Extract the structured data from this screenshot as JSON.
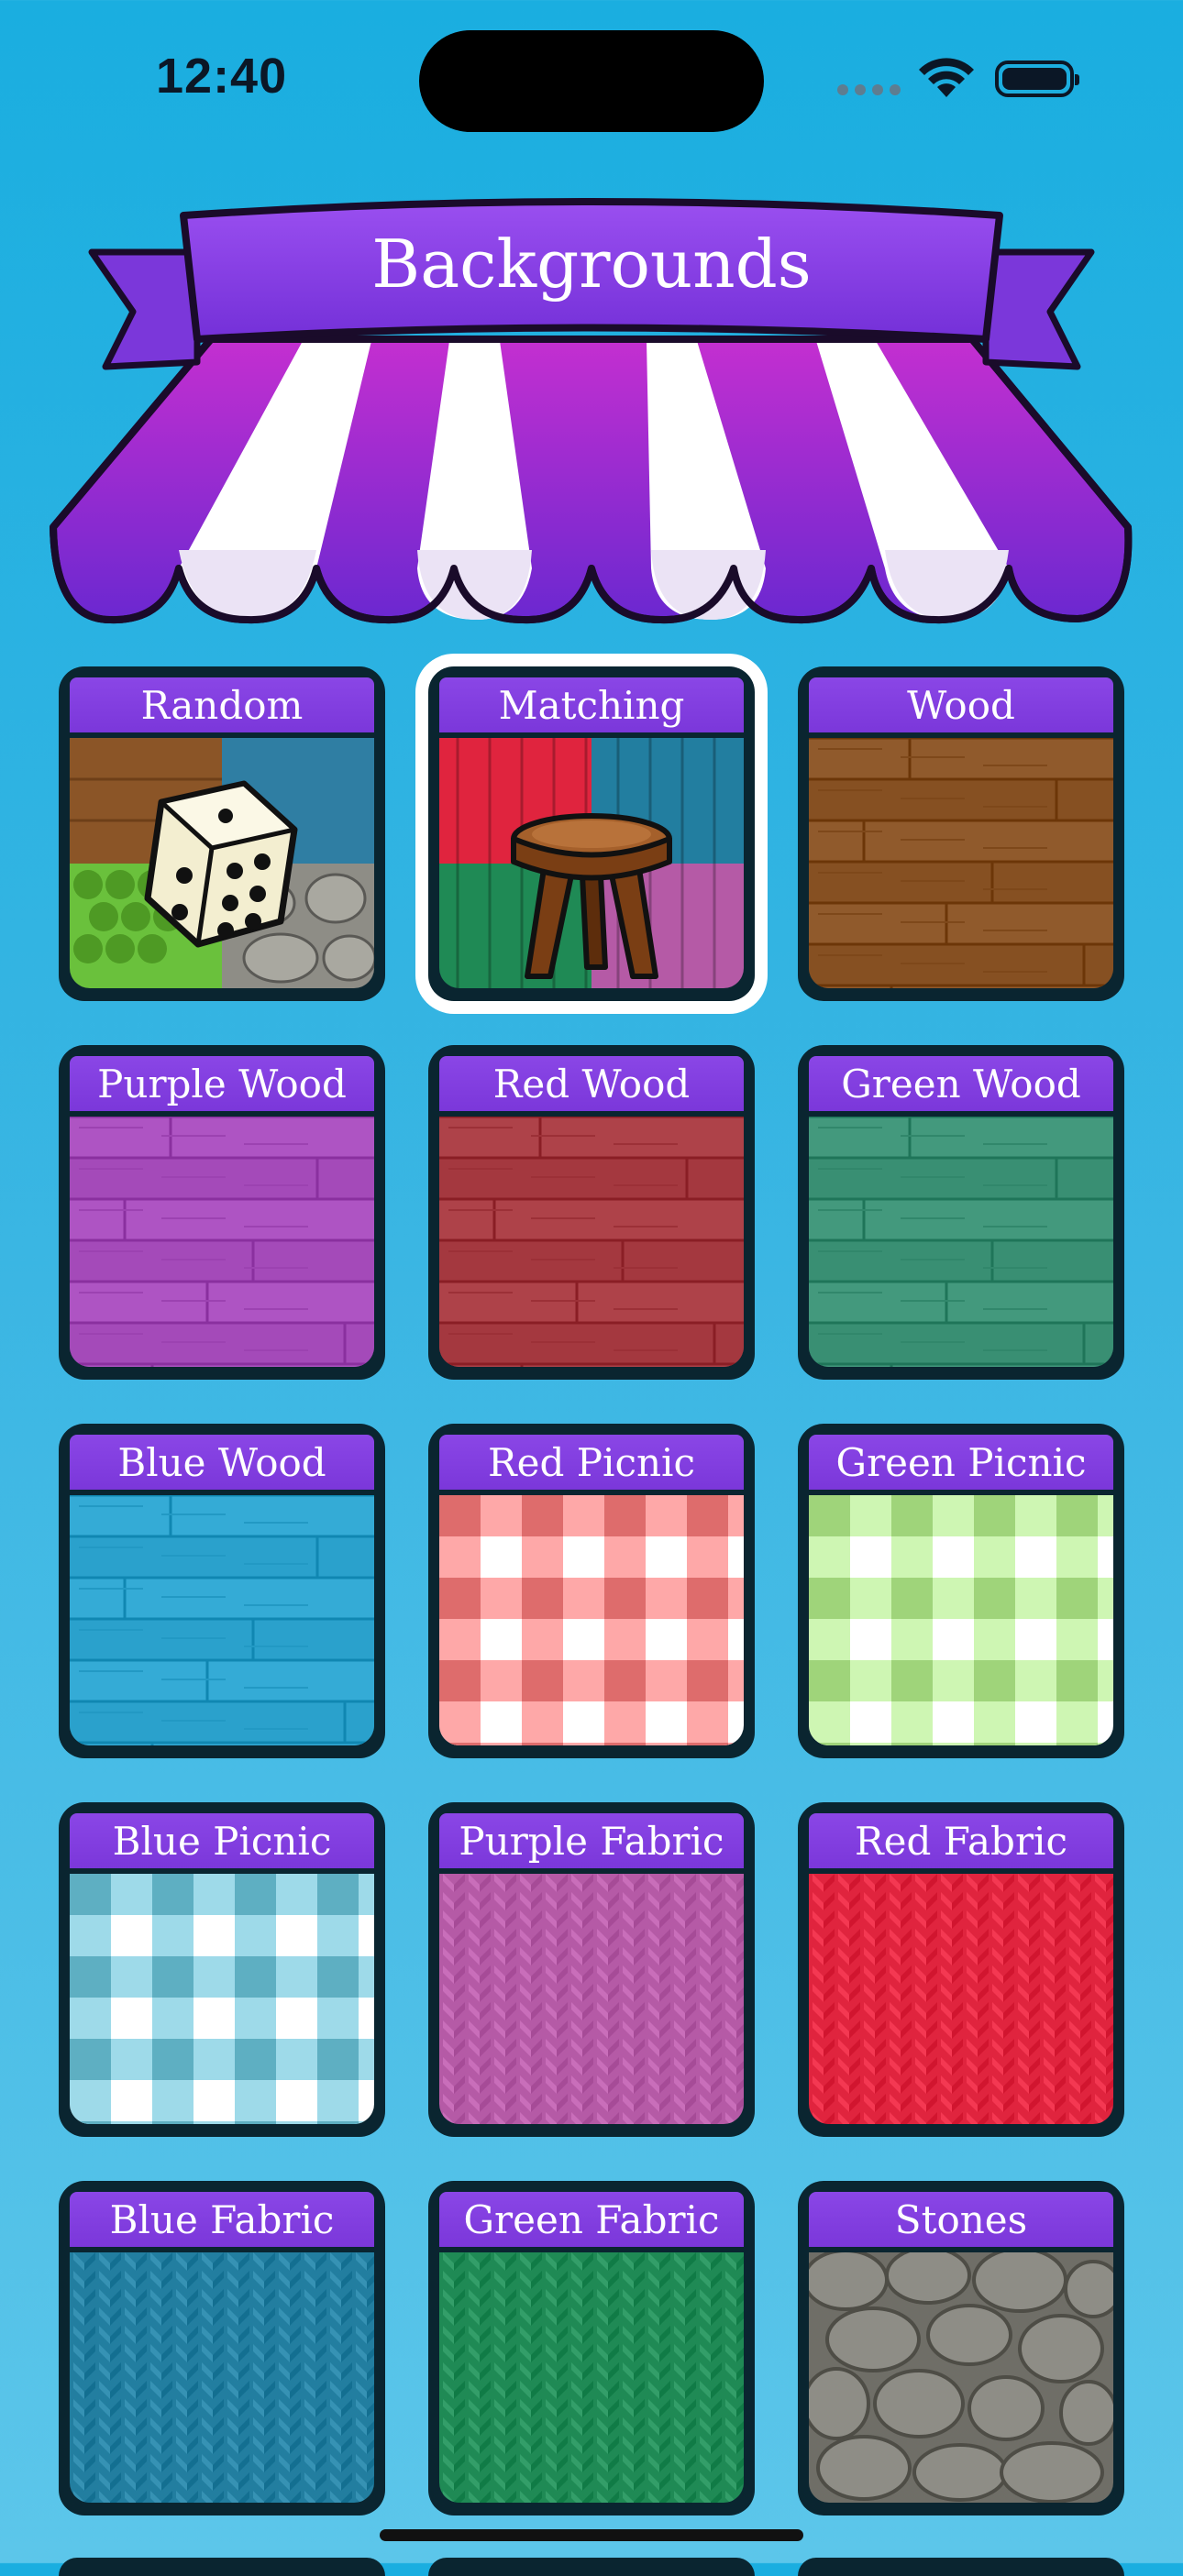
{
  "status_bar": {
    "time": "12:40",
    "icons": [
      "cellular-signal-icon",
      "wifi-icon",
      "battery-icon"
    ]
  },
  "header": {
    "title": "Backgrounds",
    "banner_color": "#7b37da",
    "awning_colors": [
      "#7b2fd6",
      "#c12cc6",
      "#ffffff"
    ]
  },
  "tiles": [
    {
      "label": "Random",
      "selected": false,
      "image": "random-dice-icon"
    },
    {
      "label": "Matching",
      "selected": true,
      "image": "stool-icon"
    },
    {
      "label": "Wood",
      "selected": false,
      "image": "wood-texture",
      "color": "#8b5527"
    },
    {
      "label": "Purple Wood",
      "selected": false,
      "image": "wood-texture",
      "color": "#a94fbe"
    },
    {
      "label": "Red Wood",
      "selected": false,
      "image": "wood-texture",
      "color": "#a93d44"
    },
    {
      "label": "Green Wood",
      "selected": false,
      "image": "wood-texture",
      "color": "#3e9478"
    },
    {
      "label": "Blue Wood",
      "selected": false,
      "image": "wood-texture",
      "color": "#2fa6d1"
    },
    {
      "label": "Red Picnic",
      "selected": false,
      "image": "picnic-texture",
      "color": "#de6c6c"
    },
    {
      "label": "Green Picnic",
      "selected": false,
      "image": "picnic-texture",
      "color": "#9fd47a"
    },
    {
      "label": "Blue Picnic",
      "selected": false,
      "image": "picnic-texture",
      "color": "#5eafc2"
    },
    {
      "label": "Purple Fabric",
      "selected": false,
      "image": "fabric-texture",
      "color": "#b55aa6"
    },
    {
      "label": "Red Fabric",
      "selected": false,
      "image": "fabric-texture",
      "color": "#e0243e"
    },
    {
      "label": "Blue Fabric",
      "selected": false,
      "image": "fabric-texture",
      "color": "#227ea0"
    },
    {
      "label": "Green Fabric",
      "selected": false,
      "image": "fabric-texture",
      "color": "#1f8a55"
    },
    {
      "label": "Stones",
      "selected": false,
      "image": "stones-texture",
      "color": "#8e8d86"
    }
  ]
}
